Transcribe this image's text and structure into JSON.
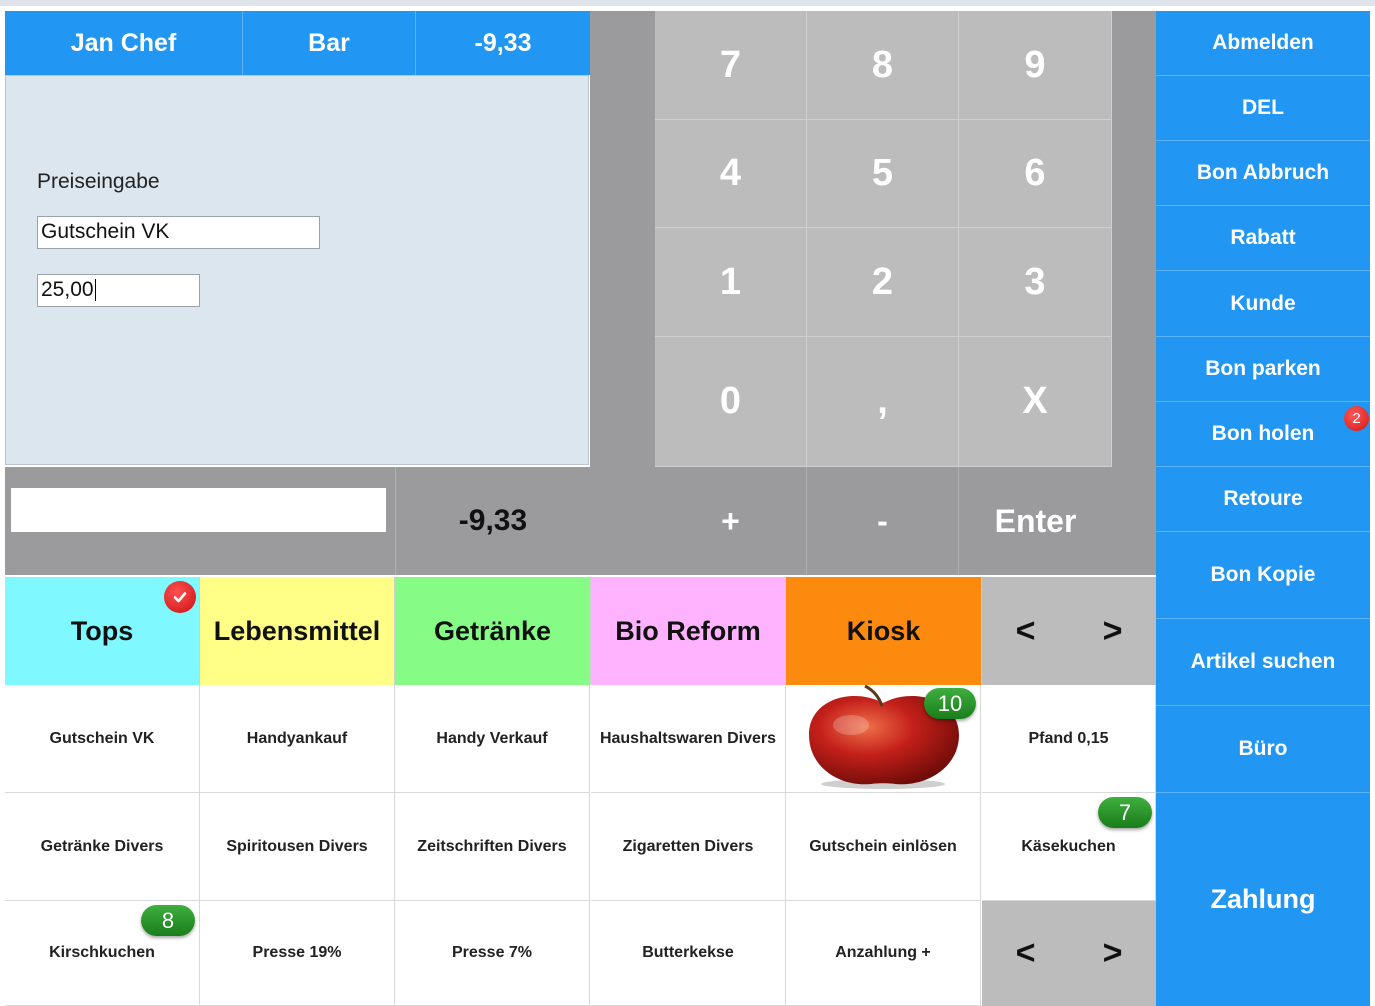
{
  "header": {
    "user": "Jan Chef",
    "mode": "Bar",
    "balance": "-9,33"
  },
  "entry": {
    "label": "Preiseingabe",
    "article_value": "Gutschein VK",
    "price_value": "25,00"
  },
  "total": {
    "value": "-9,33",
    "input_value": ""
  },
  "keypad": {
    "rows": [
      [
        "7",
        "8",
        "9"
      ],
      [
        "4",
        "5",
        "6"
      ],
      [
        "1",
        "2",
        "3"
      ],
      [
        "0",
        ",",
        "X"
      ]
    ],
    "ops": [
      "+",
      "-",
      "Enter"
    ]
  },
  "side_buttons": [
    "Abmelden",
    "DEL",
    "Bon Abbruch",
    "Rabatt",
    "Kunde",
    "Bon parken",
    "Bon holen",
    "Retoure",
    "Bon Kopie",
    "Artikel suchen",
    "Büro",
    "Zahlung"
  ],
  "parked_badge": "2",
  "categories": [
    {
      "label": "Tops",
      "color": "#80f8ff"
    },
    {
      "label": "Lebensmittel",
      "color": "#ffff88"
    },
    {
      "label": "Getränke",
      "color": "#86fc86"
    },
    {
      "label": "Bio Reform",
      "color": "#ffb3ff"
    },
    {
      "label": "Kiosk",
      "color": "#fb8a0f"
    }
  ],
  "nav": {
    "prev": "<",
    "next": ">"
  },
  "items": [
    [
      "Gutschein VK",
      "Handyankauf",
      "Handy Verkauf",
      "Haushaltswaren Divers",
      "",
      "Pfand 0,15"
    ],
    [
      "Getränke Divers",
      "Spiritousen Divers",
      "Zeitschriften Divers",
      "Zigaretten Divers",
      "Gutschein einlösen",
      "Käsekuchen"
    ],
    [
      "Kirschkuchen",
      "Presse 19%",
      "Presse 7%",
      "Butterkekse",
      "Anzahlung +",
      ""
    ]
  ],
  "item_badges": {
    "apple": "10",
    "kaesekuchen": "7",
    "kirschkuchen": "8"
  },
  "colors": {
    "accent": "#2196f3",
    "keypad": "#bcbcbc",
    "band": "#9b9b9d",
    "alert": "#e0191b"
  }
}
